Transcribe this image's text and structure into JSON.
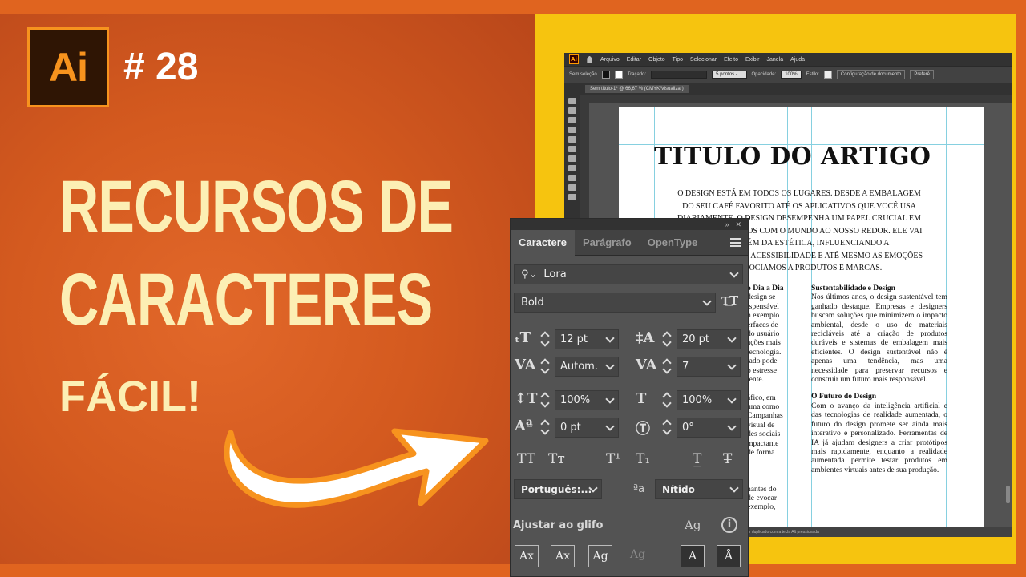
{
  "thumbnail": {
    "logo": "Ai",
    "episode": "# 28",
    "headline_line1": "RECURSOS DE",
    "headline_line2": "CARACTERES",
    "tagline": "FÁCIL!"
  },
  "illustrator": {
    "menu": [
      "Arquivo",
      "Editar",
      "Objeto",
      "Tipo",
      "Selecionar",
      "Efeito",
      "Exibir",
      "Janela",
      "Ajuda"
    ],
    "control": {
      "selection": "Sem seleção",
      "stroke_label": "Traçado:",
      "brush": "5 pontos - ...",
      "opacity_label": "Opacidade:",
      "opacity": "100%",
      "style_label": "Estilo:",
      "doc_setup": "Configuração de documento",
      "prefs": "Preferê"
    },
    "doc_tab": "Sem título-1* @ 66,67 % (CMYK/Visualizar)",
    "status": "ar duplicado com a tecla Alt pressionada",
    "document": {
      "title": "TITULO DO ARTIGO",
      "intro": "O DESIGN ESTÁ EM TODOS OS LUGARES. DESDE A EMBALAGEM DO SEU CAFÉ FAVORITO ATÉ OS APLICATIVOS QUE VOCÊ USA DIARIAMENTE, O DESIGN DESEMPENHA UM PAPEL CRUCIAL EM COMO INTERAGIMOS COM O MUNDO AO NOSSO REDOR. ELE VAI MUITO ALÉM DA ESTÉTICA, INFLUENCIANDO A FUNCIONALIDADE, ACESSIBILIDADE E ATÉ MESMO AS EMOÇÕES QUE ASSOCIAMOS A PRODUTOS E MARCAS.",
      "left_heading": "o Dia a Dia",
      "left_lines": [
        "design se",
        "ispensável",
        "n exemplo",
        "erfaces de",
        "do usuário",
        "ações mais",
        "tecnologia.",
        "tado pode",
        "o estresse",
        "iente.",
        "",
        "áfico, em",
        "uma como",
        "Campanhas",
        "visual de",
        "des sociais",
        "mpactante",
        "de forma",
        "",
        "",
        "",
        "nantes do",
        "de evocar",
        "exemplo,"
      ],
      "right_heading1": "Sustentabilidade e Design",
      "right_para1": "Nos últimos anos, o design sustentável tem ganhado destaque. Empresas e designers buscam soluções que minimizem o impacto ambiental, desde o uso de materiais recicláveis até a criação de produtos duráveis e sistemas de embalagem mais eficientes. O design sustentável não é apenas uma tendência, mas uma necessidade para preservar recursos e construir um futuro mais responsável.",
      "right_heading2": "O Futuro do Design",
      "right_para2": "Com o avanço da inteligência artificial e das tecnologias de realidade aumentada, o futuro do design promete ser ainda mais interativo e personalizado. Ferramentas de IA já ajudam designers a criar protótipos mais rapidamente, enquanto a realidade aumentada permite testar produtos em ambientes virtuais antes de sua produção."
    }
  },
  "character_panel": {
    "tabs": [
      "Caractere",
      "Parágrafo",
      "OpenType"
    ],
    "font_family": "Lora",
    "font_style": "Bold",
    "font_size": "12 pt",
    "leading": "20 pt",
    "kerning": "Autom.",
    "tracking": "7",
    "vertical_scale": "100%",
    "horizontal_scale": "100%",
    "baseline_shift": "0 pt",
    "rotation": "0°",
    "language": "Português:...",
    "antialiasing": "Nítido",
    "snap_label": "Ajustar ao glifo"
  },
  "colors": {
    "orange_bg": "#d45a1f",
    "yellow_frame": "#f6c40f",
    "headline": "#fcefb4",
    "ai_orange": "#f7931e"
  }
}
